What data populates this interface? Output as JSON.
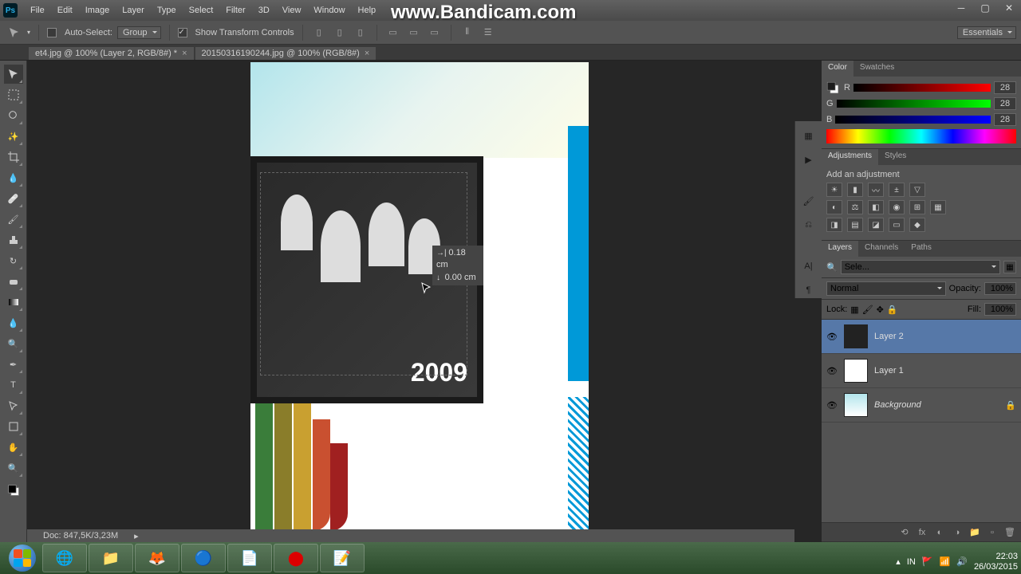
{
  "menu": [
    "File",
    "Edit",
    "Image",
    "Layer",
    "Type",
    "Select",
    "Filter",
    "3D",
    "View",
    "Window",
    "Help"
  ],
  "watermark": "www.Bandicam.com",
  "options": {
    "auto_select": "Auto-Select:",
    "group": "Group",
    "show_transform": "Show Transform Controls"
  },
  "workspace": "Essentials",
  "tabs": [
    {
      "label": "et4.jpg @ 100% (Layer 2, RGB/8#) *"
    },
    {
      "label": "20150316190244.jpg @ 100% (RGB/8#)"
    }
  ],
  "canvas": {
    "year": "2009",
    "dim_x": "0.18 cm",
    "dim_y": "0.00 cm"
  },
  "status": {
    "doc": "Doc: 847,5K/3,23M"
  },
  "color": {
    "r": "28",
    "g": "28",
    "b": "28",
    "labels": {
      "r": "R",
      "g": "G",
      "b": "B"
    }
  },
  "color_panel_tabs": [
    "Color",
    "Swatches"
  ],
  "adjustments": {
    "title": "Add an adjustment",
    "tabs": [
      "Adjustments",
      "Styles"
    ]
  },
  "layers_panel": {
    "tabs": [
      "Layers",
      "Channels",
      "Paths"
    ],
    "filter": "Sele...",
    "blend": "Normal",
    "opacity_label": "Opacity:",
    "opacity": "100%",
    "lock_label": "Lock:",
    "fill_label": "Fill:",
    "fill": "100%",
    "layers": [
      {
        "name": "Layer 2",
        "selected": true
      },
      {
        "name": "Layer 1",
        "selected": false
      },
      {
        "name": "Background",
        "selected": false,
        "locked": true,
        "italic": true
      }
    ]
  },
  "tray": {
    "lang": "IN",
    "time": "22:03",
    "date": "26/03/2015"
  }
}
